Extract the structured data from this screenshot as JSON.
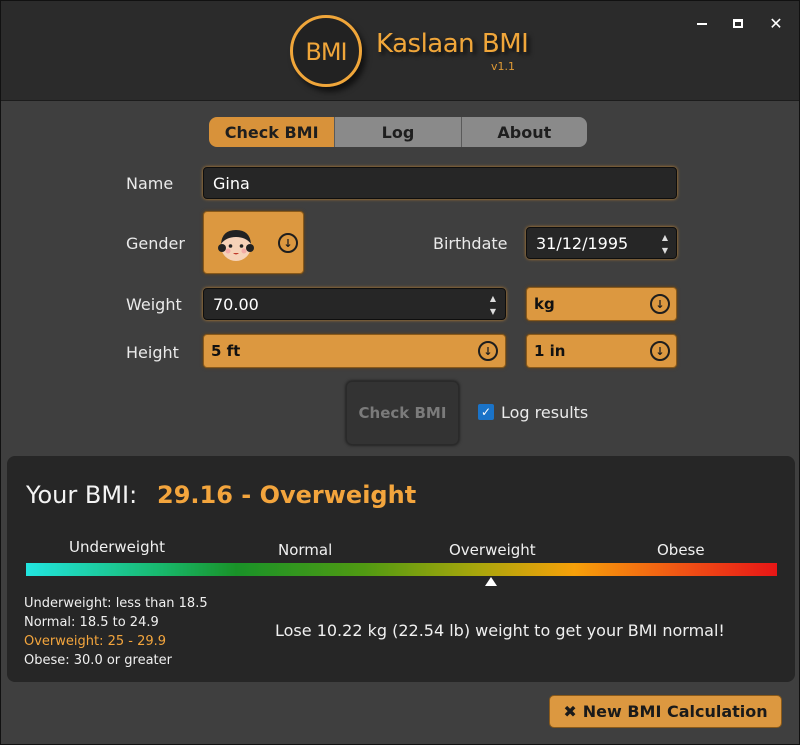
{
  "app": {
    "logo_text": "BMI",
    "title": "Kaslaan BMI",
    "version": "v1.1",
    "window_controls": {
      "close": "✕"
    }
  },
  "tabs": [
    {
      "label": "Check BMI",
      "active": true
    },
    {
      "label": "Log",
      "active": false
    },
    {
      "label": "About",
      "active": false
    }
  ],
  "form": {
    "name_label": "Name",
    "name_value": "Gina",
    "gender_label": "Gender",
    "gender_icon": "girl-face-icon",
    "birthdate_label": "Birthdate",
    "birthdate_value": "31/12/1995",
    "weight_label": "Weight",
    "weight_value": "70.00",
    "weight_unit": "kg",
    "height_label": "Height",
    "height_ft": "5 ft",
    "height_in": "1 in",
    "check_button": "Check BMI",
    "log_results_label": "Log results",
    "log_results_checked": true
  },
  "result": {
    "label": "Your BMI:",
    "value_text": "29.16 - Overweight",
    "bmi": 29.16,
    "scale_labels": [
      "Underweight",
      "Normal",
      "Overweight",
      "Obese"
    ],
    "ranges": [
      {
        "text": "Underweight: less than 18.5",
        "highlight": false
      },
      {
        "text": "Normal: 18.5 to 24.9",
        "highlight": false
      },
      {
        "text": "Overweight: 25 - 29.9",
        "highlight": true
      },
      {
        "text": "Obese: 30.0 or greater",
        "highlight": false
      }
    ],
    "advice": "Lose 10.22 kg (22.54 lb) weight to get your BMI normal!"
  },
  "new_button_label": "New BMI Calculation",
  "colors": {
    "accent": "#dc9840",
    "highlight_text": "#f3a53d"
  }
}
